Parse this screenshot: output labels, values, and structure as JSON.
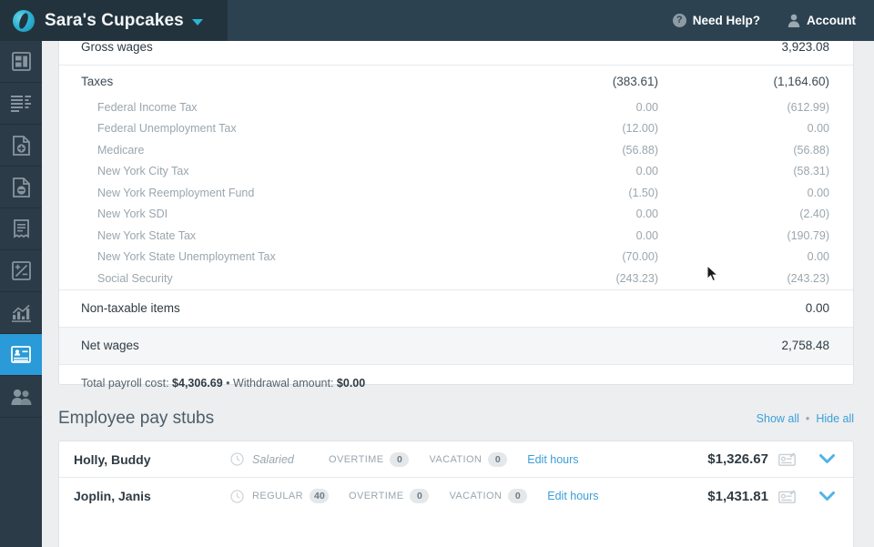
{
  "header": {
    "brand_name": "Sara's Cupcakes",
    "brand_caret_icon": "chevron-down-icon",
    "logo_icon": "company-logo-icon",
    "help_label": "Need Help?",
    "help_icon": "question-circle-icon",
    "account_label": "Account",
    "account_icon": "person-icon",
    "bar_color": "#2d4250",
    "brand_block_color": "#22333e"
  },
  "sidebar": {
    "active_color": "#2a9ad8",
    "items": [
      {
        "name": "dashboard",
        "icon": "dashboard-icon",
        "active": false
      },
      {
        "name": "reports-list",
        "icon": "list-lines-icon",
        "active": false
      },
      {
        "name": "add-document",
        "icon": "document-add-icon",
        "active": false
      },
      {
        "name": "remove-document",
        "icon": "document-minus-icon",
        "active": false
      },
      {
        "name": "receipts",
        "icon": "receipt-icon",
        "active": false
      },
      {
        "name": "adjustments",
        "icon": "plus-minus-icon",
        "active": false
      },
      {
        "name": "analytics",
        "icon": "bar-chart-icon",
        "active": false
      },
      {
        "name": "payroll",
        "icon": "id-card-icon",
        "active": true
      },
      {
        "name": "employees",
        "icon": "people-icon",
        "active": false
      }
    ]
  },
  "summary": {
    "gross_wages": {
      "label": "Gross wages",
      "col1": "",
      "col2": "3,923.08"
    },
    "taxes": {
      "label": "Taxes",
      "col1": "(383.61)",
      "col2": "(1,164.60)"
    },
    "tax_rows": [
      {
        "label": "Federal Income Tax",
        "col1": "0.00",
        "col2": "(612.99)"
      },
      {
        "label": "Federal Unemployment Tax",
        "col1": "(12.00)",
        "col2": "0.00"
      },
      {
        "label": "Medicare",
        "col1": "(56.88)",
        "col2": "(56.88)"
      },
      {
        "label": "New York City Tax",
        "col1": "0.00",
        "col2": "(58.31)"
      },
      {
        "label": "New York Reemployment Fund",
        "col1": "(1.50)",
        "col2": "0.00"
      },
      {
        "label": "New York SDI",
        "col1": "0.00",
        "col2": "(2.40)"
      },
      {
        "label": "New York State Tax",
        "col1": "0.00",
        "col2": "(190.79)"
      },
      {
        "label": "New York State Unemployment Tax",
        "col1": "(70.00)",
        "col2": "0.00"
      },
      {
        "label": "Social Security",
        "col1": "(243.23)",
        "col2": "(243.23)"
      }
    ],
    "non_taxable": {
      "label": "Non-taxable items",
      "col1": "",
      "col2": "0.00"
    },
    "net_wages": {
      "label": "Net wages",
      "col1": "",
      "col2": "2,758.48"
    },
    "footer_prefix": "Total payroll cost: ",
    "footer_total": "$4,306.69",
    "footer_middle": " • Withdrawal amount: ",
    "footer_withdrawal": "$0.00"
  },
  "paystubs": {
    "title": "Employee pay stubs",
    "show_all": "Show all",
    "separator": "•",
    "hide_all": "Hide all",
    "edit_hours_label": "Edit hours",
    "overtime_label": "OVERTIME",
    "vacation_label": "VACATION",
    "rows": [
      {
        "name": "Holly, Buddy",
        "pay_type": "Salaried",
        "pay_type_italic": true,
        "regular_label": "",
        "regular_value": "",
        "overtime_value": "0",
        "vacation_value": "0",
        "amount": "$1,326.67"
      },
      {
        "name": "Joplin, Janis",
        "pay_type": "",
        "pay_type_italic": false,
        "regular_label": "REGULAR",
        "regular_value": "40",
        "overtime_value": "0",
        "vacation_value": "0",
        "amount": "$1,431.81"
      }
    ]
  }
}
